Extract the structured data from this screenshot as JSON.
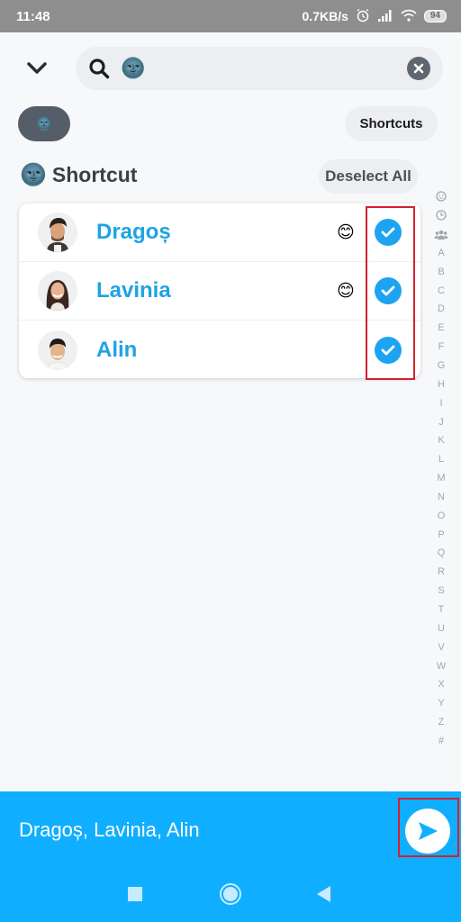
{
  "status_bar": {
    "time": "11:48",
    "network_speed": "0.7KB/s",
    "battery": "94",
    "icons": [
      "alarm-icon",
      "signal-icon",
      "wifi-icon",
      "battery-icon"
    ]
  },
  "header": {
    "back_icon": "chevron-down-icon",
    "search": {
      "icon": "search-icon",
      "value": "🌚",
      "clear_icon": "close-icon"
    }
  },
  "filters": {
    "active_chip": "🌚",
    "shortcuts_label": "Shortcuts"
  },
  "section": {
    "emoji": "🌚",
    "title": "Shortcut",
    "deselect_label": "Deselect All"
  },
  "friends": [
    {
      "name": "Dragoș",
      "emoji": "😊",
      "selected": true
    },
    {
      "name": "Lavinia",
      "emoji": "😊",
      "selected": true
    },
    {
      "name": "Alin",
      "emoji": "",
      "selected": true
    }
  ],
  "alpha_index": [
    "☺",
    "🕒",
    "👥",
    "A",
    "B",
    "C",
    "D",
    "E",
    "F",
    "G",
    "H",
    "I",
    "J",
    "K",
    "L",
    "M",
    "N",
    "O",
    "P",
    "Q",
    "R",
    "S",
    "T",
    "U",
    "V",
    "W",
    "X",
    "Y",
    "Z",
    "#"
  ],
  "send_bar": {
    "recipients": "Dragoș, Lavinia, Alin",
    "send_icon": "send-arrow-icon"
  },
  "colors": {
    "accent": "#10aefe",
    "name_blue": "#1ea3e4",
    "check_blue": "#1ea3f2",
    "highlight_red": "#d3202f"
  }
}
